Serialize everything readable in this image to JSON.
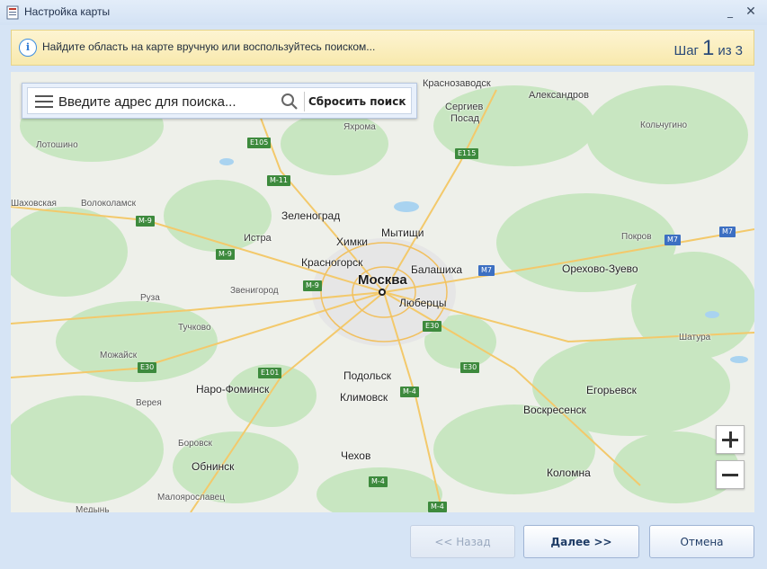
{
  "window": {
    "title": "Настройка карты",
    "minimize": "_",
    "close": "✕"
  },
  "banner": {
    "info_icon": "info-icon",
    "text": "Найдите область на карте вручную или воспользуйтесь поиском...",
    "step_prefix": "Шаг",
    "step_current": "1",
    "step_sep": "из",
    "step_total": "3"
  },
  "search": {
    "placeholder": "Введите адрес для поиска...",
    "value": "",
    "reset_label": "Сбросить поиск"
  },
  "map": {
    "capital": "Москва",
    "cities": {
      "krasnozavodsk": "Краснозаводск",
      "aleksandrov": "Александров",
      "sergiev": "Сергиев",
      "posad": "Посад",
      "kolchugino": "Кольчугино",
      "yakhroma": "Яхрома",
      "lotoshino": "Лотошино",
      "shakhovskaya": "Шаховская",
      "volokolamsk": "Волоколамск",
      "zelenograd": "Зеленоград",
      "khimki": "Химки",
      "mytishchi": "Мытищи",
      "istra": "Истра",
      "krasnogorsk": "Красногорск",
      "balashikha": "Балашиха",
      "pokrov": "Покров",
      "orekhovo": "Орехово-Зуево",
      "zvenigorod": "Звенигород",
      "ruza": "Руза",
      "lyubertsy": "Люберцы",
      "tuchkovo": "Тучково",
      "shatura": "Шатура",
      "mozhaysk": "Можайск",
      "podolsk": "Подольск",
      "naro_fominsk": "Наро-Фоминск",
      "klimovsk": "Климовск",
      "egorievsk": "Егорьевск",
      "vereya": "Верея",
      "voskresensk": "Воскресенск",
      "borovsk": "Боровск",
      "obninsk": "Обнинск",
      "chekhov": "Чехов",
      "kolomna": "Коломна",
      "maloyaroslavets": "Малоярославец",
      "medyn": "Медынь"
    },
    "roads": {
      "e105": "E105",
      "e115": "E115",
      "m11": "M-11",
      "m9a": "M-9",
      "m9b": "M-9",
      "m9c": "M-9",
      "m7a": "M7",
      "m7b": "M7",
      "m7c": "M7",
      "e30a": "E30",
      "e30b": "E30",
      "e30c": "E30",
      "e101": "E101",
      "m4a": "M-4",
      "m4b": "M-4",
      "m4c": "M-4"
    }
  },
  "footer": {
    "back": "<< Назад",
    "next": "Далее >>",
    "cancel": "Отмена"
  }
}
